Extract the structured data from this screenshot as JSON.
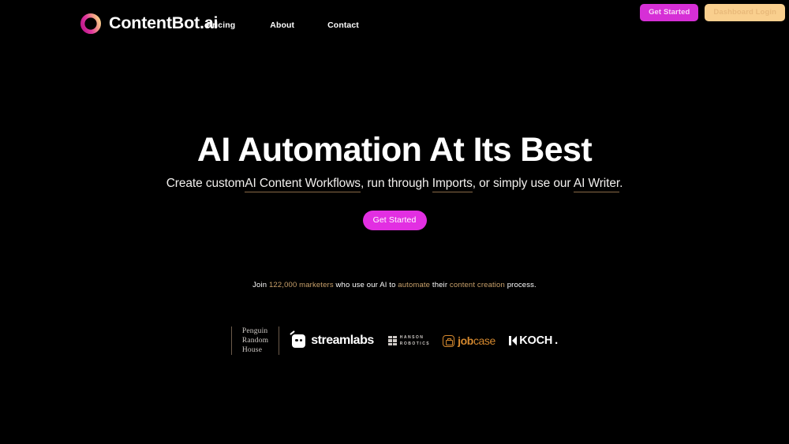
{
  "brand": {
    "name": "ContentBot.ai",
    "logo_icon": "gradient-ring-icon",
    "logo_gradient_from": "#e0379f",
    "logo_gradient_to": "#f6b97a"
  },
  "nav": {
    "items": [
      {
        "label": "Pricing"
      },
      {
        "label": "About"
      },
      {
        "label": "Contact"
      }
    ]
  },
  "header_actions": {
    "get_started_label": "Get Started",
    "get_started_bg": "#d62fd6",
    "dashboard_login_label": "Dashboard Login",
    "dashboard_login_bg": "#f9cf8e"
  },
  "hero": {
    "headline": "AI Automation At Its Best",
    "subhead": {
      "part1": "Create custom",
      "link1": "AI Content Workflows",
      "part2": ", run through ",
      "link2": "Imports",
      "part3": ", or simply use our ",
      "link3": "AI Writer",
      "part4": ".",
      "underline_color": "#8a6a46"
    },
    "cta_label": "Get Started",
    "cta_bg": "#e22fe2"
  },
  "social_proof": {
    "prefix": "Join ",
    "count_highlight": "122,000 marketers",
    "middle": " who use our AI to ",
    "highlight2": "automate",
    "middle2": " their ",
    "highlight3": "content creation",
    "suffix": " process.",
    "highlight_color": "#c8a06a"
  },
  "logo_strip": {
    "brands": [
      {
        "name": "Penguin Random House",
        "line1": "Penguin",
        "line2": "Random",
        "line3": "House"
      },
      {
        "name": "Streamlabs",
        "text": "streamlabs",
        "icon": "streamlabs-icon"
      },
      {
        "name": "Hanson Robotics",
        "line1": "HANSON",
        "line2": "ROBOTICS",
        "icon": "hanson-bars-icon"
      },
      {
        "name": "jobcase",
        "text_bold": "job",
        "text_light": "case",
        "icon": "briefcase-icon",
        "color": "#d4882e"
      },
      {
        "name": "KOCH",
        "text": "KOCH",
        "dot": ".",
        "icon": "koch-mark-icon"
      }
    ]
  }
}
